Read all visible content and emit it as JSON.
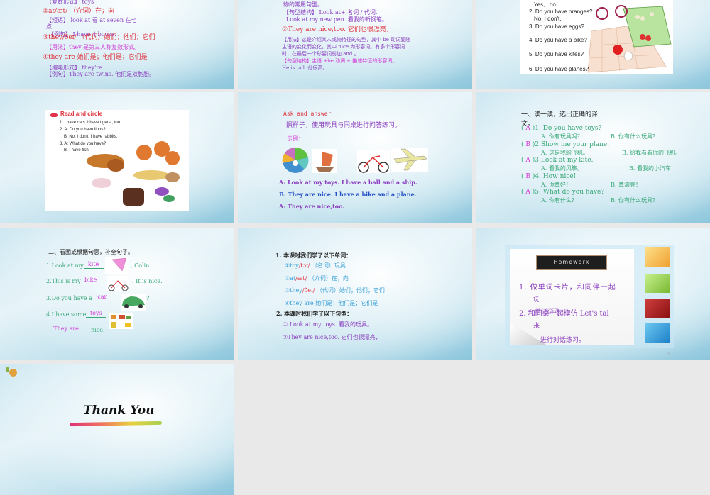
{
  "slides": [
    {
      "lines": [
        "【复数形式】 toys",
        "②at/æt/ （介词）在；向",
        "【短语】 look at 看   at seven 在七",
        "点",
        "【例句】 I have 4 books.",
        "③they/ðeɪ/ （代词）她们；他们；它们",
        "【用法】they 是第三人称复数形式。",
        "④they are 她们是；他们是；它们是",
        "【缩略形式】 they're",
        "【例句】They are twins. 他们是双胞胎。"
      ]
    },
    {
      "lines": [
        "物的常用句型。",
        "【句型结构】 Look at+ 名词 / 代词.",
        "Look at my new pen. 看我的新钢笔。",
        "②They are nice,too. 它们也很漂亮，",
        "【用法】这是介绍某人或物特征的句型，其中 be 动词要随",
        "主语的变化而变化，其中 nice 为形容词。有多个形容词",
        "时，在最后一个形容词前加 and 。",
        "【句型结构】主语 +be 动词 + 描述特征的形容词。",
        "He is tall. 他很高。"
      ]
    },
    {
      "lines": [
        "Yes, I do.",
        "2. Do you have oranges?",
        "No, I don't.",
        "3. Do you have eggs?",
        "4. Do you have a bike?",
        "5. Do you have kites?",
        "6. Do you have planes?"
      ]
    },
    {
      "title": "Read and circle",
      "lines": [
        "1. I have cats. I have tigers , too.",
        "2. A: Do you have lions?",
        "B: No, I don't. I have rabbits.",
        "3. A: What do you have?",
        "B: I have fish."
      ]
    },
    {
      "title": "Ask and answer",
      "instruction": "照样子，使用玩具与同桌进行问答练习。",
      "example": "示例：",
      "dialog": [
        "A: Look at my toys. I have a ball and a ship.",
        "B: They are nice. I have a bike and a plane.",
        "A: They are nice,too."
      ]
    },
    {
      "heading": "一、读一读，选出正确的译",
      "heading2": "文。",
      "items": [
        {
          "ans": "A",
          "q": ")1. Do you have toys?",
          "a": "A. 你有玩具吗？",
          "b": "B. 你有什么玩具？"
        },
        {
          "ans": "B",
          "q": ")2.Show me your plane.",
          "a": "A. 这是我的飞机。",
          "b": "B. 给我看看你的飞机。"
        },
        {
          "ans": "A",
          "q": ")3.Look at my kite.",
          "a": "A. 看我的风筝。",
          "b": "B. 看我的小汽车"
        },
        {
          "ans": "B",
          "q": ")4. How nice!",
          "a": "A. 你真好！",
          "b": "B. 真漂亮！"
        },
        {
          "ans": "A",
          "q": ")5. What do you have?",
          "a": "A. 你有什么？",
          "b": "B. 你有什么玩具？"
        }
      ]
    },
    {
      "heading": "二、看图或根据句意，补全句子。",
      "items": [
        {
          "pre": "1.Look at my",
          "ans": "kite",
          "post": ", Colin."
        },
        {
          "pre": "2.This is my",
          "ans": "bike",
          "post": ". It is nice."
        },
        {
          "pre": "3.Do you have a",
          "ans": "car",
          "post": "?"
        },
        {
          "pre": "4.I have some",
          "ans": "toys",
          "post": "."
        }
      ],
      "last": {
        "ans1": "They",
        "ans2": "are",
        "post": "nice."
      }
    },
    {
      "h1": "1. 本课时我们学了以下单词：",
      "words": [
        {
          "w": "①toy",
          "p": "/tɔɪ/",
          "m": "（名词）玩具"
        },
        {
          "w": "②at",
          "p": "/æt/",
          "m": "（介词）在；向"
        },
        {
          "w": "③they",
          "p": "/ðeɪ/",
          "m": "（代词）她们；他们；它们"
        },
        {
          "w": "④they are",
          "p": "",
          "m": "她们是；他们是；它们是"
        }
      ],
      "h2": "2. 本课时我们学了以下句型：",
      "sentences": [
        "① Look at my toys. 看我的玩具。",
        "②They are nice,too. 它们也很漂亮，"
      ]
    },
    {
      "board": "Homework",
      "lines": [
        "1. 做单词卡片，和同伴一起",
        "玩",
        "2. 和同桌一起模仿 Let's tal",
        "来",
        "进行对话练习。"
      ],
      "overlap": "单词游戏",
      "page": "19",
      "colors": [
        "#f0a830",
        "#8cc63c",
        "#a81818",
        "#1e88d0"
      ]
    },
    {
      "title": "Thank You"
    }
  ]
}
